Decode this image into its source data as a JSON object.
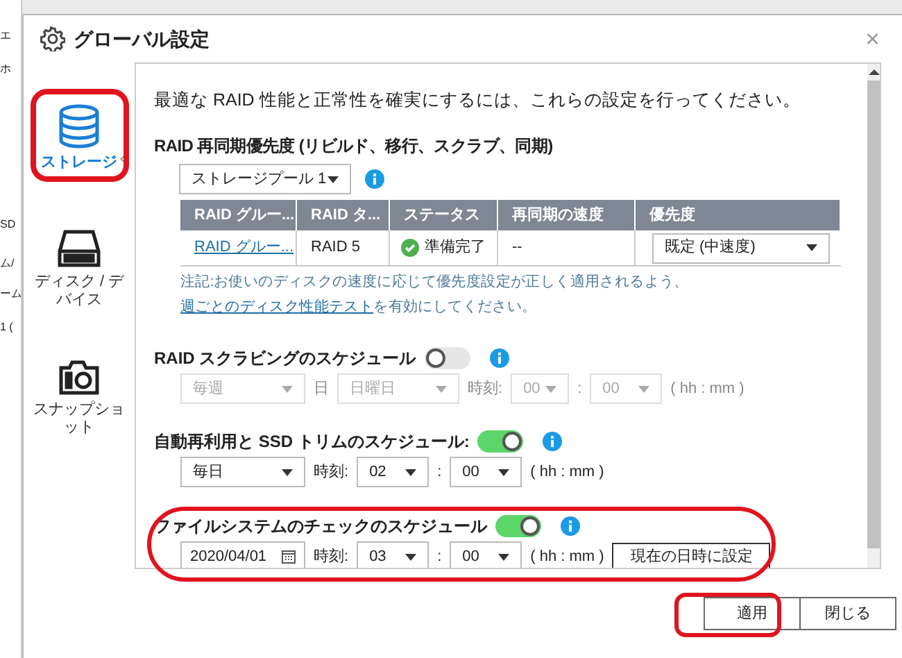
{
  "background_window": {
    "texts": [
      "エ",
      "ホ",
      "SD",
      "ム/",
      "ーム",
      "1 ("
    ]
  },
  "dialog": {
    "title": "グローバル設定",
    "close": "×"
  },
  "sidebar": {
    "items": [
      {
        "label": "ストレージ",
        "selected": true,
        "kind": "storage"
      },
      {
        "label": "ディスク / デバイス",
        "selected": false,
        "kind": "disk"
      },
      {
        "label": "スナップショット",
        "selected": false,
        "kind": "snapshot"
      }
    ]
  },
  "intro": "最適な RAID 性能と正常性を確実にするには、これらの設定を行ってください。",
  "resync": {
    "title": "RAID 再同期優先度 (リビルド、移行、スクラブ、同期)",
    "pool": "ストレージプール 1",
    "table": {
      "columns": [
        "RAID グルー...",
        "RAID タ...",
        "ステータス",
        "再同期の速度",
        "優先度"
      ],
      "rows": [
        {
          "group": "RAID グルー...",
          "type": "RAID 5",
          "status": "準備完了",
          "speed": "--",
          "priority": "既定 (中速度)"
        }
      ]
    },
    "note": "注記:お使いのディスクの速度に応じて優先度設定が正しく適用されるよう、",
    "note_link": "週ごとのディスク性能テスト",
    "note_end": "を有効にしてください。"
  },
  "scrubbing": {
    "title": "RAID スクラビングのスケジュール",
    "on": false,
    "frequency": "毎週",
    "day_label": "日",
    "day": "日曜日",
    "time_label": "時刻:",
    "hour": "00",
    "separator": ":",
    "minute": "00",
    "format": "( hh : mm )"
  },
  "trim": {
    "title": "自動再利用と SSD トリムのスケジュール:",
    "on": true,
    "frequency": "毎日",
    "time_label": "時刻:",
    "hour": "02",
    "separator": ":",
    "minute": "00",
    "format": "( hh : mm )"
  },
  "fs_check": {
    "title": "ファイルシステムのチェックのスケジュール",
    "on": true,
    "date": "2020/04/01",
    "time_label": "時刻:",
    "hour": "03",
    "separator": ":",
    "minute": "00",
    "format": "( hh : mm )",
    "set_now": "現在の日時に設定"
  },
  "buttons": [
    {
      "label": "適用"
    },
    {
      "label": "閉じる"
    }
  ]
}
